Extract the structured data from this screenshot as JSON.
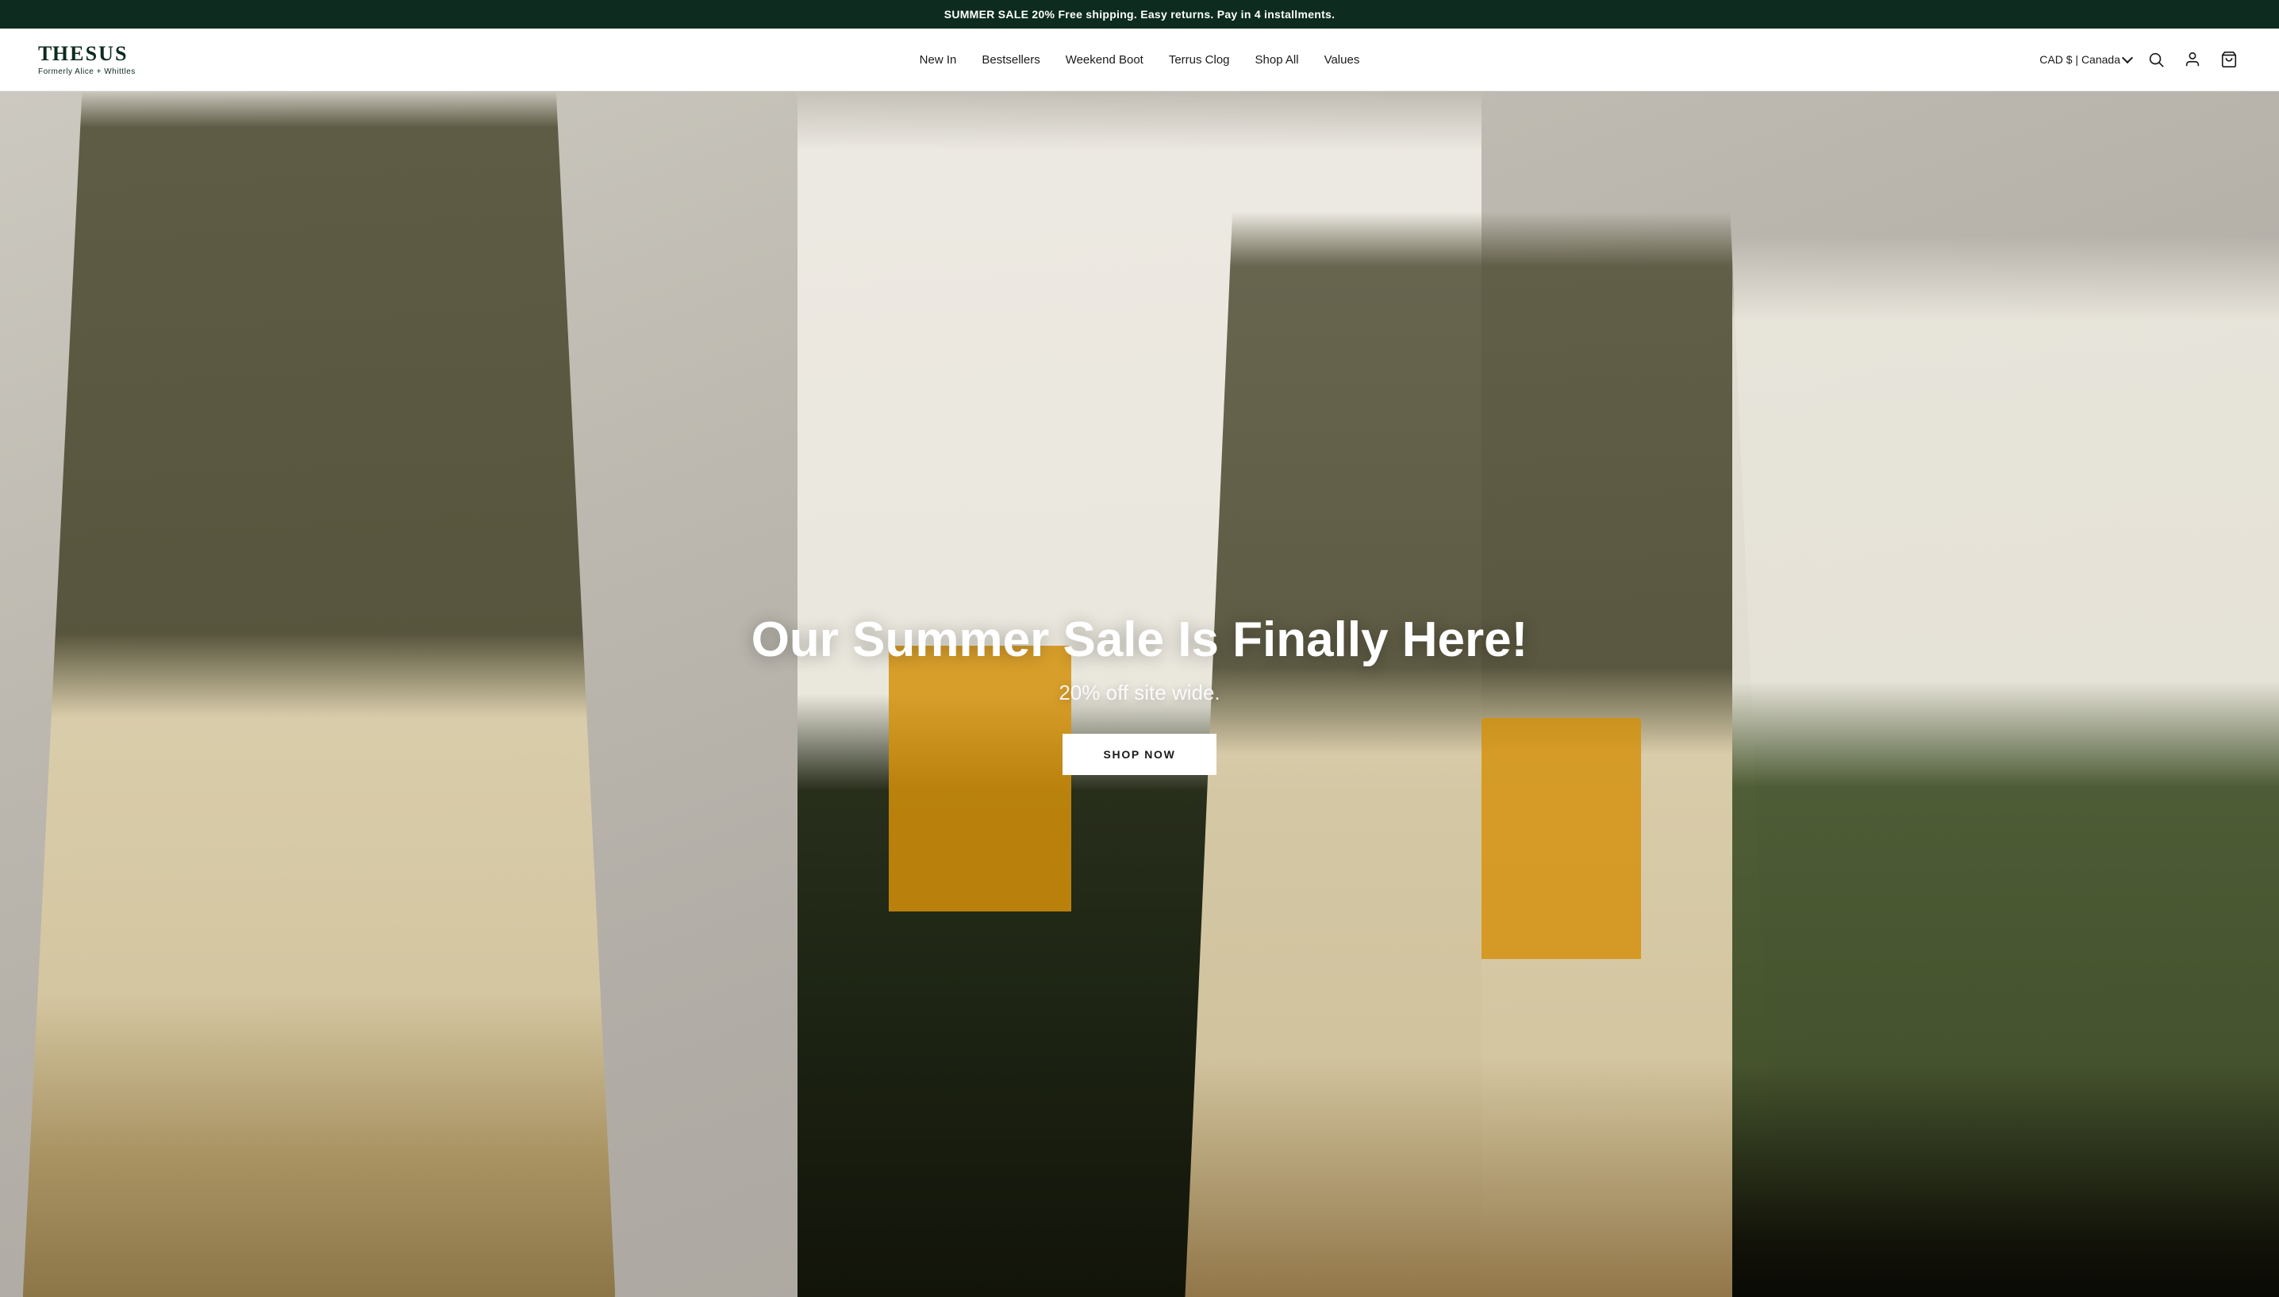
{
  "announcement": {
    "text": "SUMMER SALE 20% Free shipping. Easy returns. Pay in 4 installments."
  },
  "header": {
    "logo": {
      "brand": "THESUS",
      "subtitle": "Formerly Alice + Whittles"
    },
    "nav": {
      "items": [
        {
          "id": "new-in",
          "label": "New In"
        },
        {
          "id": "bestsellers",
          "label": "Bestsellers"
        },
        {
          "id": "weekend-boot",
          "label": "Weekend Boot"
        },
        {
          "id": "terrus-clog",
          "label": "Terrus Clog"
        },
        {
          "id": "shop-all",
          "label": "Shop All"
        },
        {
          "id": "values",
          "label": "Values"
        }
      ]
    },
    "currency": {
      "label": "CAD $ | Canada"
    },
    "actions": {
      "search": "Search",
      "login": "Log in",
      "cart": "Cart"
    }
  },
  "hero": {
    "title": "Our Summer Sale Is Finally Here!",
    "subtitle": "20% off site wide.",
    "cta_label": "SHOP NOW"
  }
}
